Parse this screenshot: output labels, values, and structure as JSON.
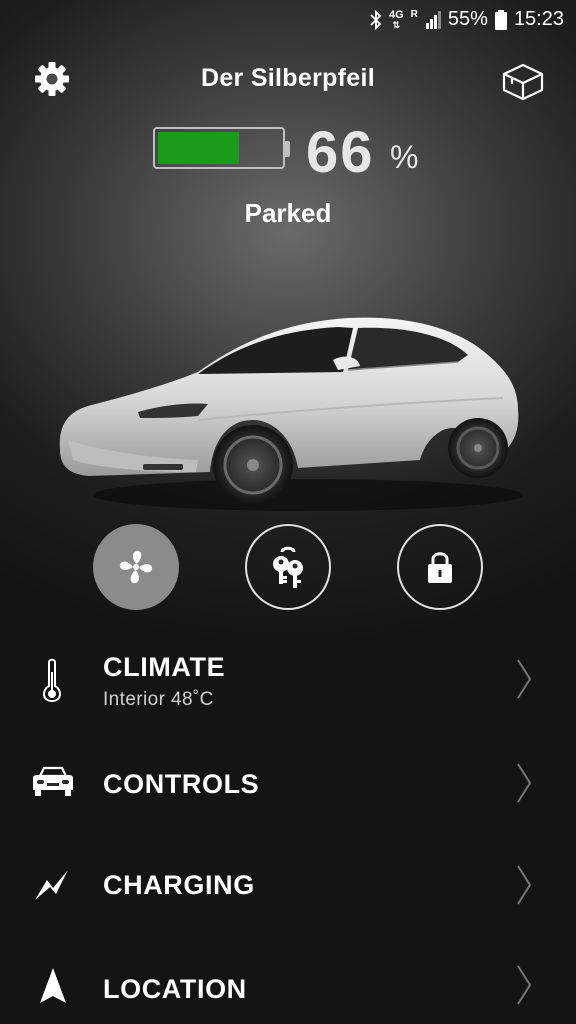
{
  "status_bar": {
    "network": "4G",
    "roaming": "R",
    "battery_percent": "55%",
    "time": "15:23",
    "icons": [
      "bluetooth-icon",
      "signal-icon",
      "battery-icon"
    ]
  },
  "header": {
    "title": "Der Silberpfeil",
    "left_icon": "gear-icon",
    "right_icon": "box-icon"
  },
  "battery": {
    "level": 0.66,
    "percent_value": "66",
    "percent_sign": "%",
    "fill_color": "#1a9b1a"
  },
  "vehicle": {
    "status": "Parked"
  },
  "actions": [
    {
      "name": "fan",
      "icon": "fan-icon",
      "active": true
    },
    {
      "name": "keys",
      "icon": "keys-icon",
      "active": false
    },
    {
      "name": "lock",
      "icon": "lock-icon",
      "active": false
    }
  ],
  "menu": {
    "climate": {
      "label": "CLIMATE",
      "sub": "Interior 48˚C",
      "icon": "thermometer-icon"
    },
    "controls": {
      "label": "CONTROLS",
      "icon": "car-front-icon"
    },
    "charging": {
      "label": "CHARGING",
      "icon": "lightning-icon"
    },
    "location": {
      "label": "LOCATION",
      "icon": "navigation-arrow-icon"
    }
  }
}
